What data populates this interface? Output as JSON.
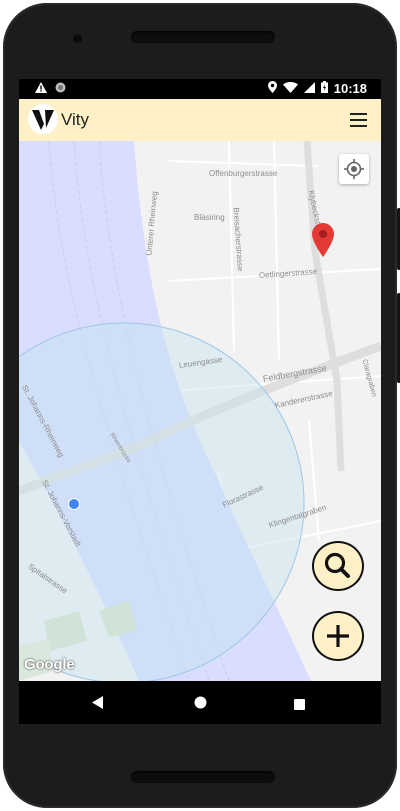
{
  "status_bar": {
    "time": "10:18",
    "left_icons": [
      "warning-icon",
      "sync-icon"
    ],
    "right_icons": [
      "location-icon",
      "wifi-icon",
      "signal-icon",
      "battery-icon"
    ]
  },
  "app_bar": {
    "logo_letter": "V",
    "title": "Vity",
    "menu_icon": "hamburger-menu-icon"
  },
  "map": {
    "streets": [
      "Offenburgerstrasse",
      "Unterer Rheinweg",
      "Bläsiring",
      "Breisacherstrasse",
      "Klybeckstrasse",
      "Oetlingerstrasse",
      "Leuengasse",
      "Feldbergstrasse",
      "Kandererstrasse",
      "Florastrasse",
      "Klingentalgraben",
      "St. Johanns-Rheinweg",
      "St. Johanns-Vorstadt",
      "Spitalstrasse",
      "Rheinbrücke",
      "Claragraben"
    ],
    "attribution": "Google",
    "locate_icon": "my-location-icon",
    "marker_icon": "map-pin-icon",
    "user_location_icon": "user-location-dot"
  },
  "fabs": {
    "search_icon": "search-icon",
    "add_icon": "plus-icon"
  },
  "nav_bar": {
    "icons": [
      "back-icon",
      "home-icon",
      "recents-icon"
    ]
  },
  "colors": {
    "app_bar": "#fff1c7",
    "river": "#d9ddff",
    "radius_fill": "#c6e2ef",
    "pin": "#e53935",
    "user_dot": "#4285f4"
  }
}
